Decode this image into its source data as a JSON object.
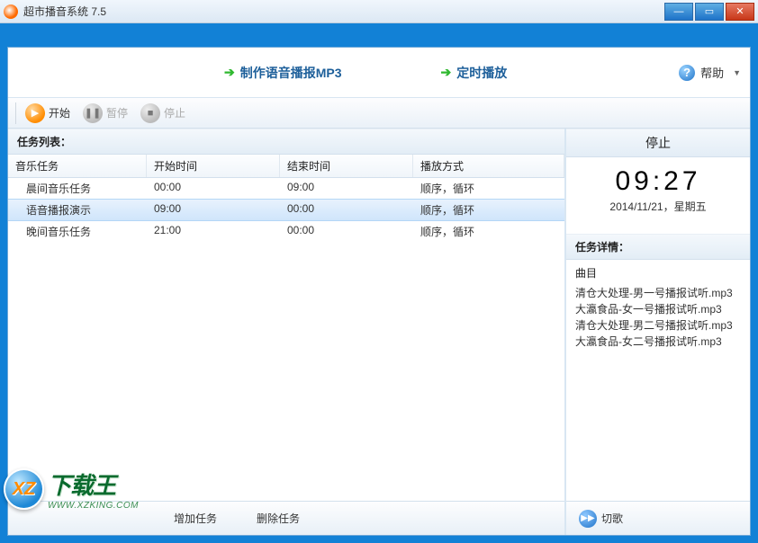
{
  "window": {
    "title": "超市播音系统 7.5"
  },
  "topActions": {
    "makeMp3": "制作语音播报MP3",
    "scheduled": "定时播放",
    "help": "帮助"
  },
  "playback": {
    "start": "开始",
    "pause": "暂停",
    "stop": "停止"
  },
  "taskList": {
    "header": "任务列表：",
    "columns": {
      "task": "音乐任务",
      "start": "开始时间",
      "end": "结束时间",
      "mode": "播放方式"
    },
    "rows": [
      {
        "task": "晨间音乐任务",
        "start": "00:00",
        "end": "09:00",
        "mode": "顺序，循环",
        "selected": false
      },
      {
        "task": "语音播报演示",
        "start": "09:00",
        "end": "00:00",
        "mode": "顺序，循环",
        "selected": true
      },
      {
        "task": "晚间音乐任务",
        "start": "21:00",
        "end": "00:00",
        "mode": "顺序，循环",
        "selected": false
      }
    ],
    "footer": {
      "add": "增加任务",
      "delete": "删除任务"
    }
  },
  "status": {
    "state": "停止",
    "time": "09:27",
    "date": "2014/11/21，星期五"
  },
  "details": {
    "header": "任务详情：",
    "trackLabel": "曲目",
    "tracks": [
      "清仓大处理-男一号播报试听.mp3",
      "大瀛食品-女一号播报试听.mp3",
      "清仓大处理-男二号播报试听.mp3",
      "大瀛食品-女二号播报试听.mp3"
    ],
    "skip": "切歌"
  },
  "logo": {
    "cn": "下载王",
    "url": "WWW.XZKING.COM",
    "badge": "XZ"
  }
}
